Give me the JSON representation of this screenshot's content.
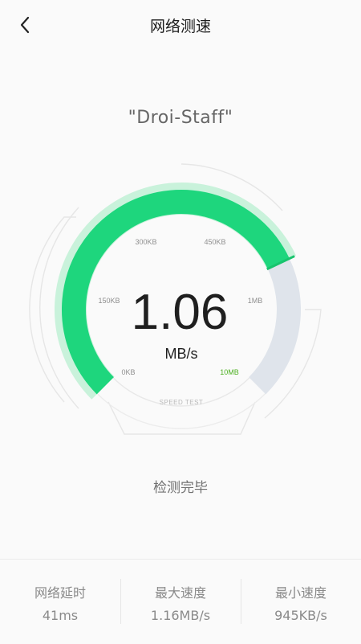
{
  "header": {
    "title": "网络测速",
    "back_icon": "chevron-left-icon"
  },
  "network": {
    "ssid": "\"Droi-Staff\""
  },
  "gauge": {
    "speed_value": "1.06",
    "speed_unit": "MB/s",
    "speed_fraction": 0.74,
    "scale_labels": [
      "0KB",
      "150KB",
      "300KB",
      "450KB",
      "1MB",
      "10MB"
    ],
    "caption": "SPEED TEST",
    "colors": {
      "fill": "#1ed67d",
      "fill_light": "#a8ecc6",
      "track": "#dfe4eb",
      "ring": "#e4e4e4",
      "max_label": "#4caf20"
    }
  },
  "status": {
    "text": "检测完毕"
  },
  "stats": [
    {
      "label": "网络延时",
      "value": "41ms"
    },
    {
      "label": "最大速度",
      "value": "1.16MB/s"
    },
    {
      "label": "最小速度",
      "value": "945KB/s"
    }
  ]
}
